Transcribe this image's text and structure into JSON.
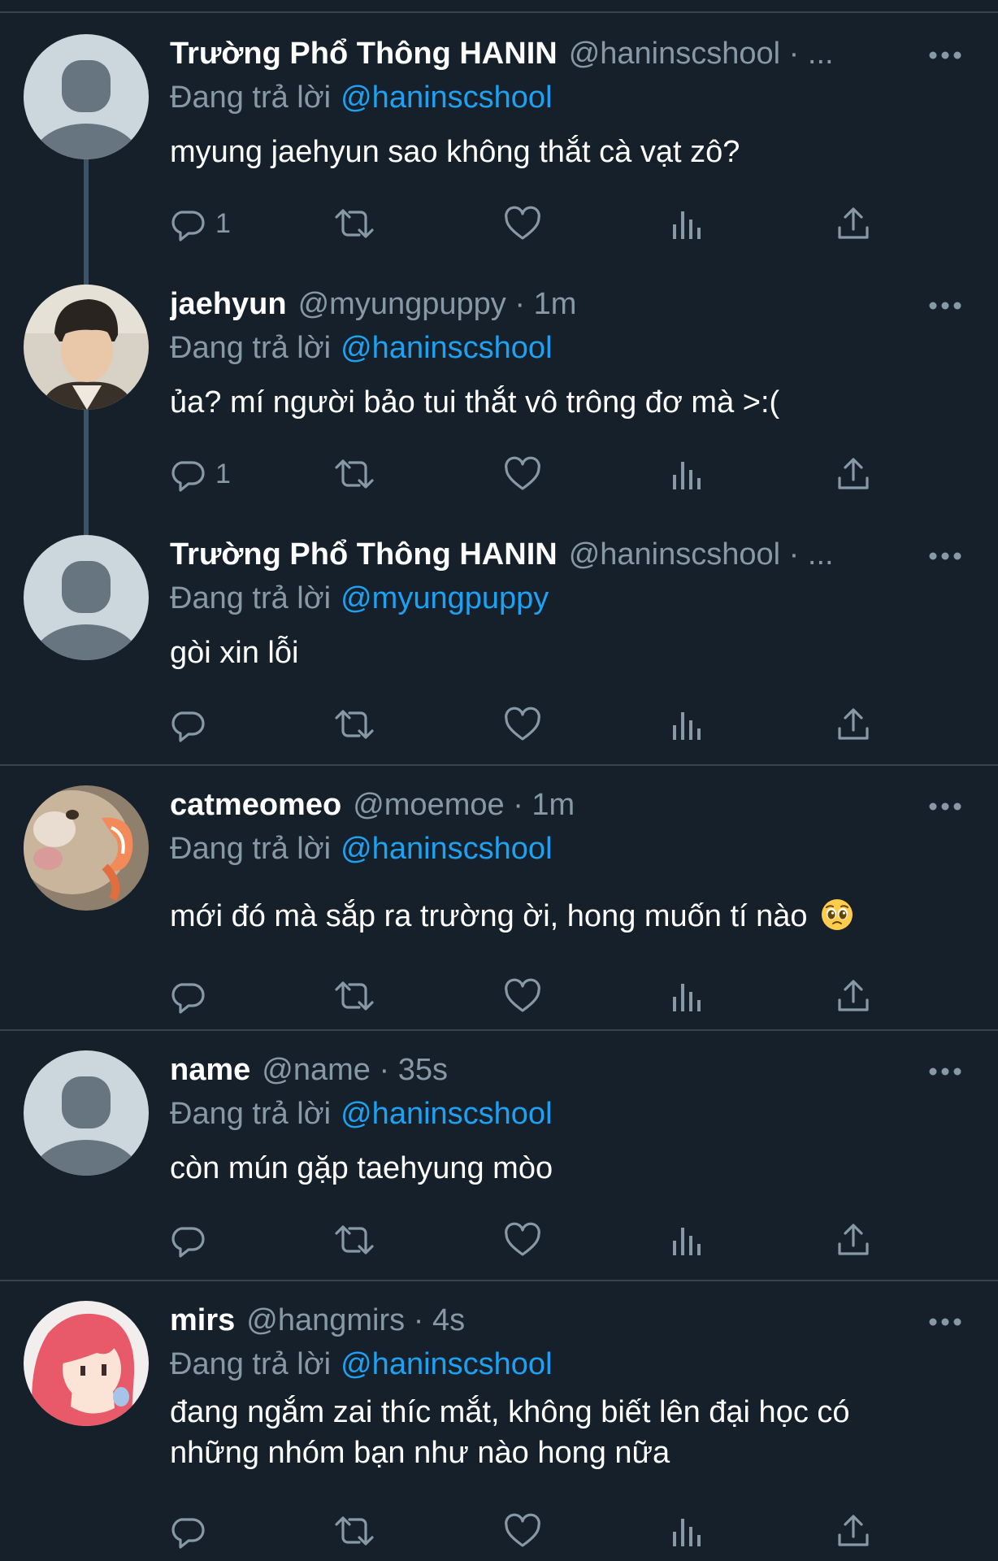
{
  "tweets": [
    {
      "display_name": "Trường Phổ Thông HANIN",
      "handle": "@haninscshool",
      "dot": "·",
      "time": "...",
      "reply_prefix": "Đang trả lời",
      "reply_to": "@haninscshool",
      "text": "myung jaehyun sao không thắt cà vạt zô?",
      "reply_count": "1",
      "avatar": "default-avatar-icon"
    },
    {
      "display_name": "jaehyun",
      "handle": "@myungpuppy",
      "dot": "·",
      "time": "1m",
      "reply_prefix": "Đang trả lời",
      "reply_to": "@haninscshool",
      "text": "ủa? mí người bảo tui thắt vô trông đơ mà >:(",
      "reply_count": "1",
      "avatar": "photo-avatar"
    },
    {
      "display_name": "Trường Phổ Thông HANIN",
      "handle": "@haninscshool",
      "dot": "·",
      "time": "...",
      "reply_prefix": "Đang trả lời",
      "reply_to": "@myungpuppy",
      "text": "gòi xin lỗi",
      "reply_count": "",
      "avatar": "default-avatar-icon"
    },
    {
      "display_name": "catmeomeo",
      "handle": "@moemoe",
      "dot": "·",
      "time": "1m",
      "reply_prefix": "Đang trả lời",
      "reply_to": "@haninscshool",
      "text": "mới đó mà sắp ra trường ời, hong muốn tí nào",
      "emoji": "pleading-face-emoji",
      "reply_count": "",
      "avatar": "cat-photo-avatar"
    },
    {
      "display_name": "name",
      "handle": "@name",
      "dot": "·",
      "time": "35s",
      "reply_prefix": "Đang trả lời",
      "reply_to": "@haninscshool",
      "text": "còn mún gặp taehyung mòo",
      "reply_count": "",
      "avatar": "default-avatar-icon"
    },
    {
      "display_name": "mirs",
      "handle": "@hangmirs",
      "dot": "·",
      "time": "4s",
      "reply_prefix": "Đang trả lời",
      "reply_to": "@haninscshool",
      "text_line1": "đang ngắm zai thíc mắt, không biết lên đại học có",
      "text_line2": "những nhóm bạn như nào hong nữa",
      "reply_count": "",
      "avatar": "anime-avatar"
    }
  ],
  "icons": {
    "reply": "reply-icon",
    "retweet": "retweet-icon",
    "like": "heart-icon",
    "views": "views-icon",
    "share": "share-icon",
    "more": "more-icon"
  },
  "colors": {
    "background": "#15202b",
    "text_primary": "#ffffff",
    "text_secondary": "#8899a6",
    "link": "#1da1f2",
    "divider": "#38444d",
    "thread_line": "#3d5466"
  }
}
